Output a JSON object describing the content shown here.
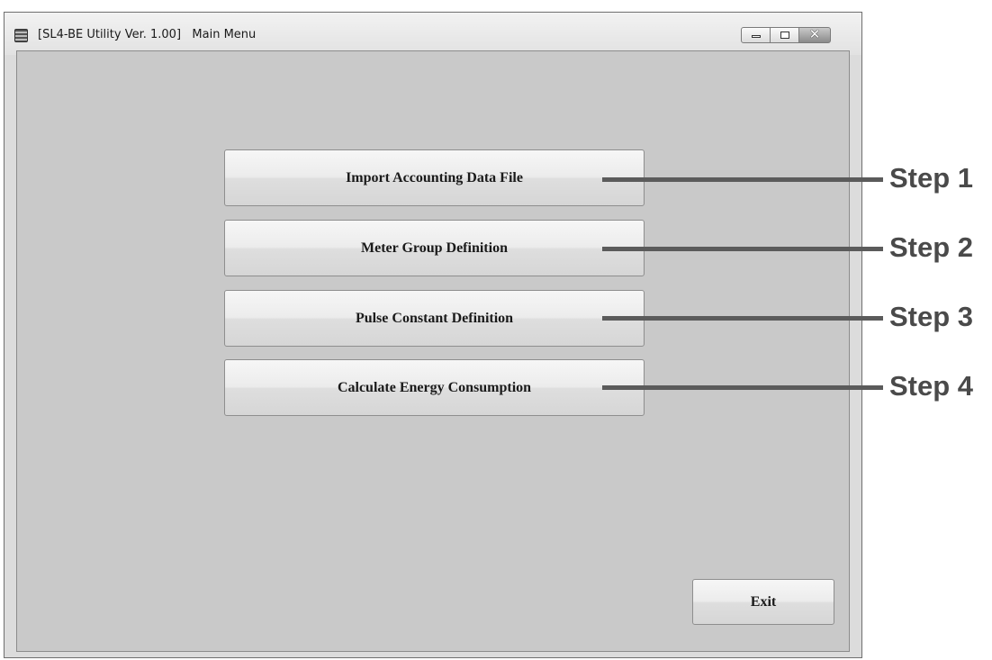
{
  "window": {
    "title": "[SL4-BE Utility Ver. 1.00]   Main Menu",
    "minimize_icon": "minimize-icon",
    "maximize_icon": "maximize-icon",
    "close_icon": "close-icon",
    "close_glyph": "✕"
  },
  "main": {
    "buttons": [
      {
        "label": "Import Accounting Data File"
      },
      {
        "label": "Meter Group Definition"
      },
      {
        "label": "Pulse Constant Definition"
      },
      {
        "label": "Calculate Energy Consumption"
      }
    ],
    "exit_label": "Exit"
  },
  "callouts": [
    {
      "label": "Step 1"
    },
    {
      "label": "Step 2"
    },
    {
      "label": "Step 3"
    },
    {
      "label": "Step 4"
    }
  ],
  "colors": {
    "client_background": "#c9c9c9",
    "callout": "#5b5b5b"
  }
}
